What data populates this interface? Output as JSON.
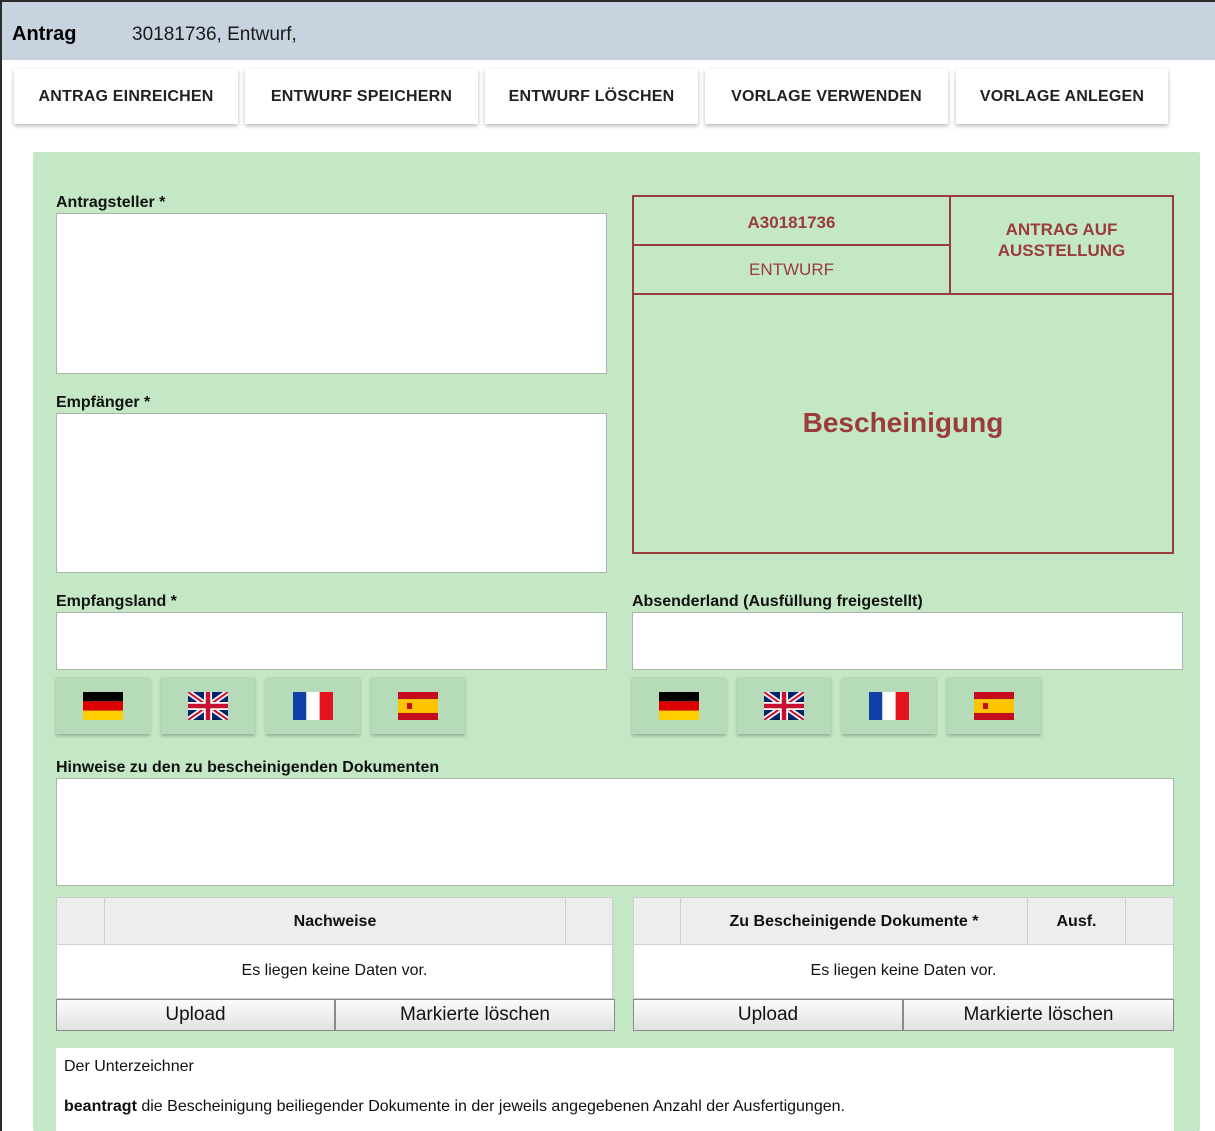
{
  "header": {
    "title": "Antrag",
    "subtitle": "30181736, Entwurf,"
  },
  "toolbar": {
    "submit": "ANTRAG EINREICHEN",
    "save": "ENTWURF SPEICHERN",
    "delete": "ENTWURF LÖSCHEN",
    "use_template": "VORLAGE VERWENDEN",
    "create_template": "VORLAGE ANLEGEN"
  },
  "form": {
    "applicant_label": "Antragsteller *",
    "applicant_value": "",
    "recipient_label": "Empfänger *",
    "recipient_value": "",
    "dest_country_label": "Empfangsland *",
    "dest_country_value": "",
    "origin_country_label": "Absenderland (Ausfüllung freigestellt)",
    "origin_country_value": "",
    "notes_label": "Hinweise zu den zu bescheinigenden Dokumenten",
    "notes_value": ""
  },
  "certificate": {
    "number": "A30181736",
    "state": "ENTWURF",
    "kind": "ANTRAG AUF AUSSTELLUNG",
    "title": "Bescheinigung"
  },
  "flags": [
    "flag-germany-icon",
    "flag-uk-icon",
    "flag-france-icon",
    "flag-spain-icon"
  ],
  "tables": {
    "evidence": {
      "columns": [
        "",
        "Nachweise",
        ""
      ],
      "empty": "Es liegen keine Daten vor.",
      "upload": "Upload",
      "delete_marked": "Markierte löschen"
    },
    "documents": {
      "columns": [
        "",
        "Zu Bescheinigende Dokumente *",
        "Ausf.",
        ""
      ],
      "empty": "Es liegen keine Daten vor.",
      "upload": "Upload",
      "delete_marked": "Markierte löschen"
    }
  },
  "declaration": {
    "line1": "Der Unterzeichner",
    "line2_bold": "beantragt",
    "line2_rest": " die Bescheinigung beiliegender Dokumente in der jeweils angegebenen Anzahl der Ausfertigungen."
  },
  "colors": {
    "panel": "#c4e8c6",
    "accent": "#9b3b3b",
    "titlebar": "#c8d3e0"
  }
}
